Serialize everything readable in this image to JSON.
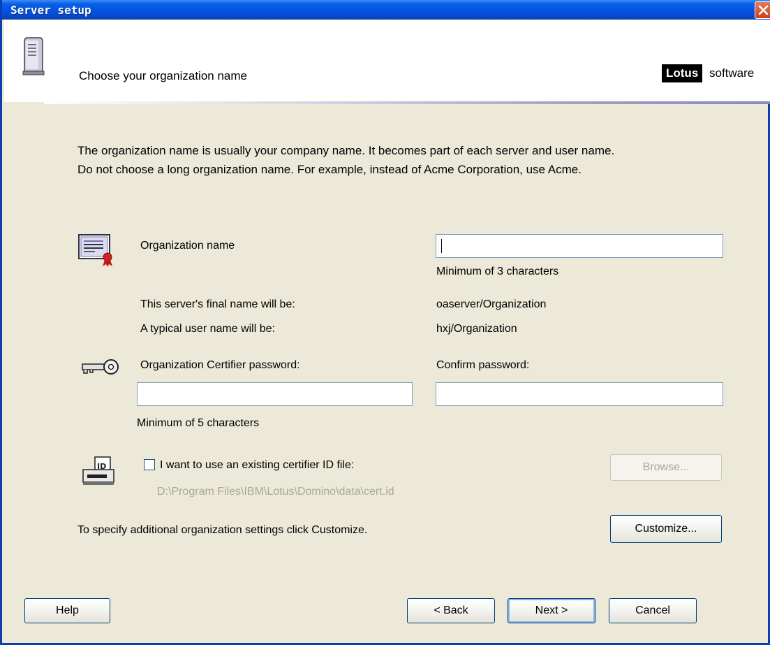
{
  "window": {
    "title": "Server setup"
  },
  "header": {
    "title": "Choose your organization name"
  },
  "logo": {
    "brand": "Lotus",
    "suffix": "software"
  },
  "description": {
    "line1": "The organization name is usually your company name. It becomes part of each server and user name.",
    "line2": "Do not choose a long organization name. For example, instead of Acme Corporation, use Acme."
  },
  "org": {
    "label": "Organization name",
    "value": "",
    "hint": "Minimum of 3 characters"
  },
  "server_name": {
    "label": "This server's final name will be:",
    "value": "oaserver/Organization"
  },
  "user_name": {
    "label": "A typical user name will be:",
    "value": "hxj/Organization"
  },
  "certifier": {
    "password_label": "Organization Certifier password:",
    "confirm_label": "Confirm password:",
    "password_value": "",
    "confirm_value": "",
    "hint": "Minimum of 5 characters"
  },
  "cert_file": {
    "checkbox_label": "I want to use an existing certifier ID file:",
    "checked": false,
    "path": "D:\\Program Files\\IBM\\Lotus\\Domino\\data\\cert.id",
    "browse_label": "Browse..."
  },
  "customize": {
    "text": "To specify additional organization settings click Customize.",
    "button_label": "Customize..."
  },
  "buttons": {
    "help": "Help",
    "back": "< Back",
    "next": "Next >",
    "cancel": "Cancel"
  },
  "colors": {
    "titlebar": "#0054e3",
    "dialog_bg": "#ece9d8",
    "input_border": "#7f9db9",
    "disabled_text": "#a8a89a"
  }
}
